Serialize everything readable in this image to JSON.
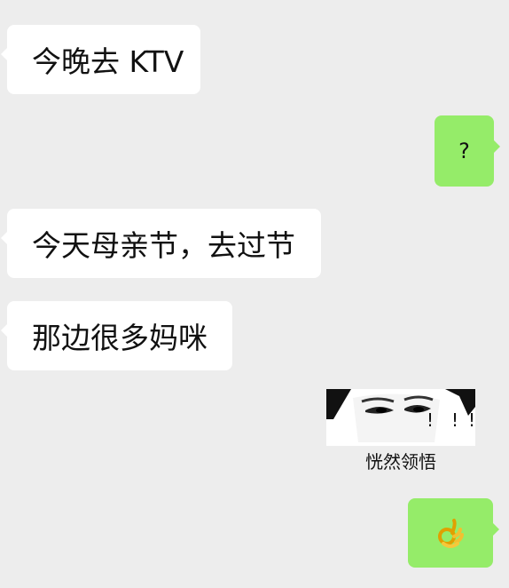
{
  "messages": [
    {
      "side": "left",
      "text": "今晚去 KTV"
    },
    {
      "side": "right",
      "text": "?"
    },
    {
      "side": "left",
      "text": "今天母亲节，去过节"
    },
    {
      "side": "left",
      "text": "那边很多妈咪"
    },
    {
      "side": "left",
      "type": "sticker",
      "caption": "恍然领悟",
      "icon": "shocked-face-sticker"
    },
    {
      "side": "right",
      "type": "emoji",
      "icon": "ok-hand-icon"
    }
  ],
  "colors": {
    "background": "#ededed",
    "incoming_bubble": "#ffffff",
    "outgoing_bubble": "#95ec69"
  }
}
